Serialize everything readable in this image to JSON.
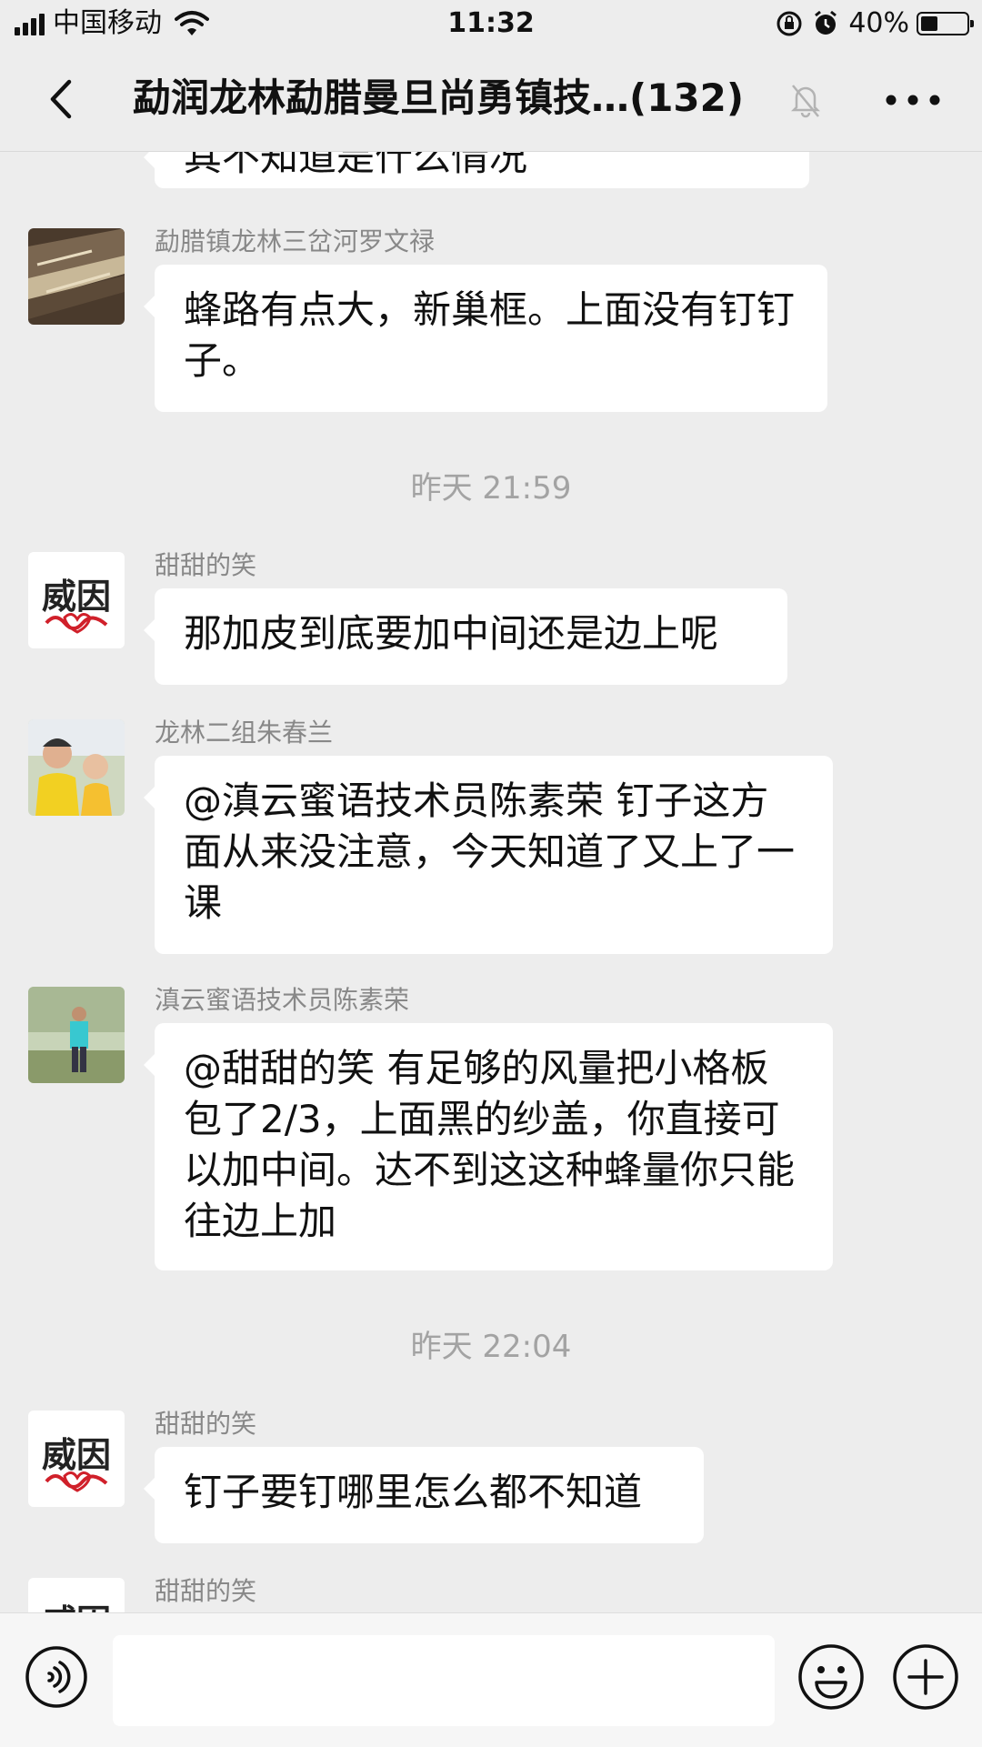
{
  "status_bar": {
    "carrier": "中国移动",
    "time": "11:32",
    "battery": "40%"
  },
  "nav": {
    "title": "勐润龙林勐腊曼旦尚勇镇技…",
    "member_count": "(132)"
  },
  "messages": [
    {
      "sender": "",
      "text": "其不知道是什么情况"
    },
    {
      "sender": "勐腊镇龙林三岔河罗文禄",
      "text": "蜂路有点大，新巢框。上面没有钉钉子。"
    },
    {
      "sender": "甜甜的笑",
      "text": "那加皮到底要加中间还是边上呢"
    },
    {
      "sender": "龙林二组朱春兰",
      "text": "@滇云蜜语技术员陈素荣 钉子这方面从来没注意，今天知道了又上了一课"
    },
    {
      "sender": "滇云蜜语技术员陈素荣",
      "text": "@甜甜的笑 有足够的风量把小格板包了2/3，上面黑的纱盖，你直接可以加中间。达不到这这种蜂量你只能往边上加"
    },
    {
      "sender": "甜甜的笑",
      "text": "钉子要钉哪里怎么都不知道"
    },
    {
      "sender": "甜甜的笑",
      "text": ""
    }
  ],
  "time_dividers": [
    "昨天 21:59",
    "昨天 22:04"
  ],
  "avatars": {
    "weiyin_text": "威因"
  },
  "icons": {
    "back": "chevron-left-icon",
    "mute": "bell-off-icon",
    "more": "ellipsis-icon",
    "voice": "voice-icon",
    "emoji": "emoji-icon",
    "plus": "plus-icon"
  }
}
